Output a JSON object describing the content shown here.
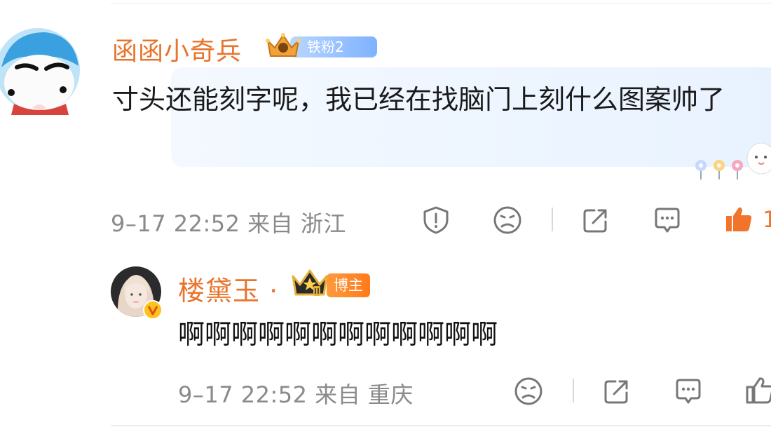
{
  "comment": {
    "username": "函函小奇兵",
    "fan_badge": "铁粉2",
    "text": "寸头还能刻字呢，我已经在找脑门上刻什么图案帅了",
    "meta": "9–17 22:52 来自 浙江",
    "actions": [
      "report-icon",
      "dislike-icon",
      "share-icon",
      "comment-icon",
      "like-icon"
    ],
    "like_count_partial": "1"
  },
  "reply": {
    "username": "楼黛玉 ·",
    "role_badge": "博主",
    "text": "啊啊啊啊啊啊啊啊啊啊啊啊",
    "meta": "9–17 22:52 来自 重庆",
    "actions": [
      "dislike-icon",
      "share-icon",
      "comment-icon",
      "like-icon"
    ]
  },
  "colors": {
    "username": "#e8742c",
    "meta": "#8a8a8a",
    "like_active": "#f2742b",
    "fan_badge": "#7fb2ff",
    "bozhu_badge": "#ff7a1a"
  }
}
